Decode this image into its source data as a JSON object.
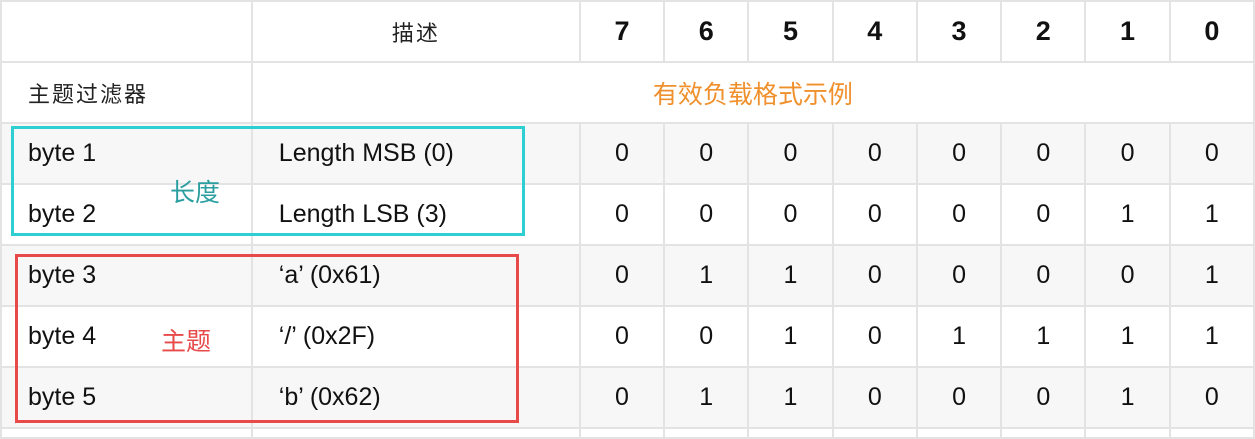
{
  "header": {
    "desc_label": "描述",
    "bits": [
      "7",
      "6",
      "5",
      "4",
      "3",
      "2",
      "1",
      "0"
    ]
  },
  "subheader": {
    "filter_label": "主题过滤器",
    "payload_label": "有效负载格式示例"
  },
  "rows": [
    {
      "byte": "byte 1",
      "desc": "Length MSB (0)",
      "bits": [
        "0",
        "0",
        "0",
        "0",
        "0",
        "0",
        "0",
        "0"
      ]
    },
    {
      "byte": "byte 2",
      "desc": "Length LSB (3)",
      "bits": [
        "0",
        "0",
        "0",
        "0",
        "0",
        "0",
        "1",
        "1"
      ]
    },
    {
      "byte": "byte 3",
      "desc": "‘a’ (0x61)",
      "bits": [
        "0",
        "1",
        "1",
        "0",
        "0",
        "0",
        "0",
        "1"
      ]
    },
    {
      "byte": "byte 4",
      "desc": "‘/’ (0x2F)",
      "bits": [
        "0",
        "0",
        "1",
        "0",
        "1",
        "1",
        "1",
        "1"
      ]
    },
    {
      "byte": "byte 5",
      "desc": "‘b’ (0x62)",
      "bits": [
        "0",
        "1",
        "1",
        "0",
        "0",
        "0",
        "1",
        "0"
      ]
    }
  ],
  "annotations": {
    "length": {
      "label": "长度",
      "color": "#2dcfd3"
    },
    "topic": {
      "label": "主题",
      "color": "#e84a4a"
    }
  },
  "colors": {
    "payload_label": "#f0902c",
    "grid_line": "#e3e3e3",
    "alt_row": "#f7f7f7"
  }
}
